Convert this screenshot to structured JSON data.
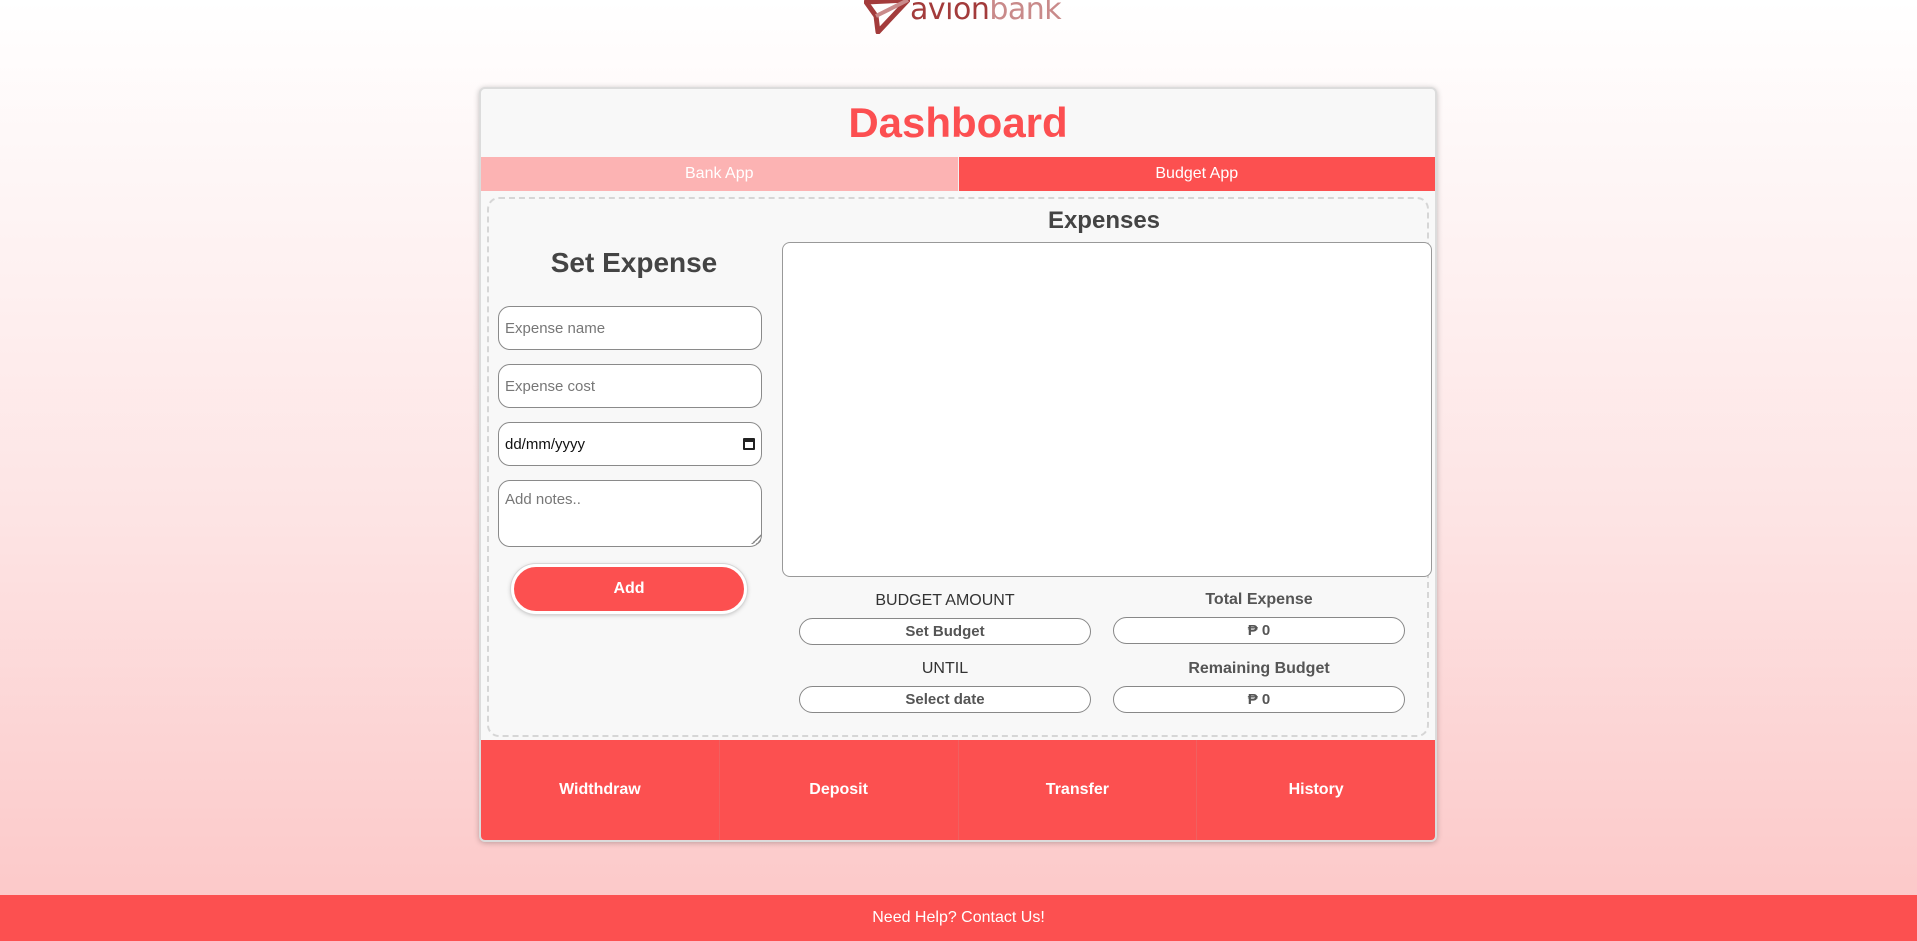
{
  "logo": {
    "text_part1": "avion",
    "text_part2": "bank"
  },
  "dashboard": {
    "title": "Dashboard"
  },
  "tabs": [
    {
      "label": "Bank App"
    },
    {
      "label": "Budget App"
    }
  ],
  "set_expense": {
    "heading": "Set Expense",
    "name_placeholder": "Expense name",
    "cost_placeholder": "Expense cost",
    "date_value": "dd/mm/yyyy",
    "notes_placeholder": "Add notes..",
    "add_label": "Add"
  },
  "expenses": {
    "heading": "Expenses"
  },
  "budget": {
    "budget_amount_label": "BUDGET AMOUNT",
    "budget_amount_value": "Set Budget",
    "total_expense_label": "Total Expense",
    "total_expense_value": "₱ 0",
    "until_label": "UNTIL",
    "until_value": "Select date",
    "remaining_label": "Remaining Budget",
    "remaining_value": "₱ 0"
  },
  "actions": [
    {
      "label": "Widthdraw"
    },
    {
      "label": "Deposit"
    },
    {
      "label": "Transfer"
    },
    {
      "label": "History"
    }
  ],
  "footer": {
    "text": "Need Help? Contact Us!"
  },
  "colors": {
    "accent": "#fc5050",
    "tab_inactive": "#fcb3b3",
    "logo_dark": "#a33b3b",
    "logo_light": "#c98a8a"
  }
}
